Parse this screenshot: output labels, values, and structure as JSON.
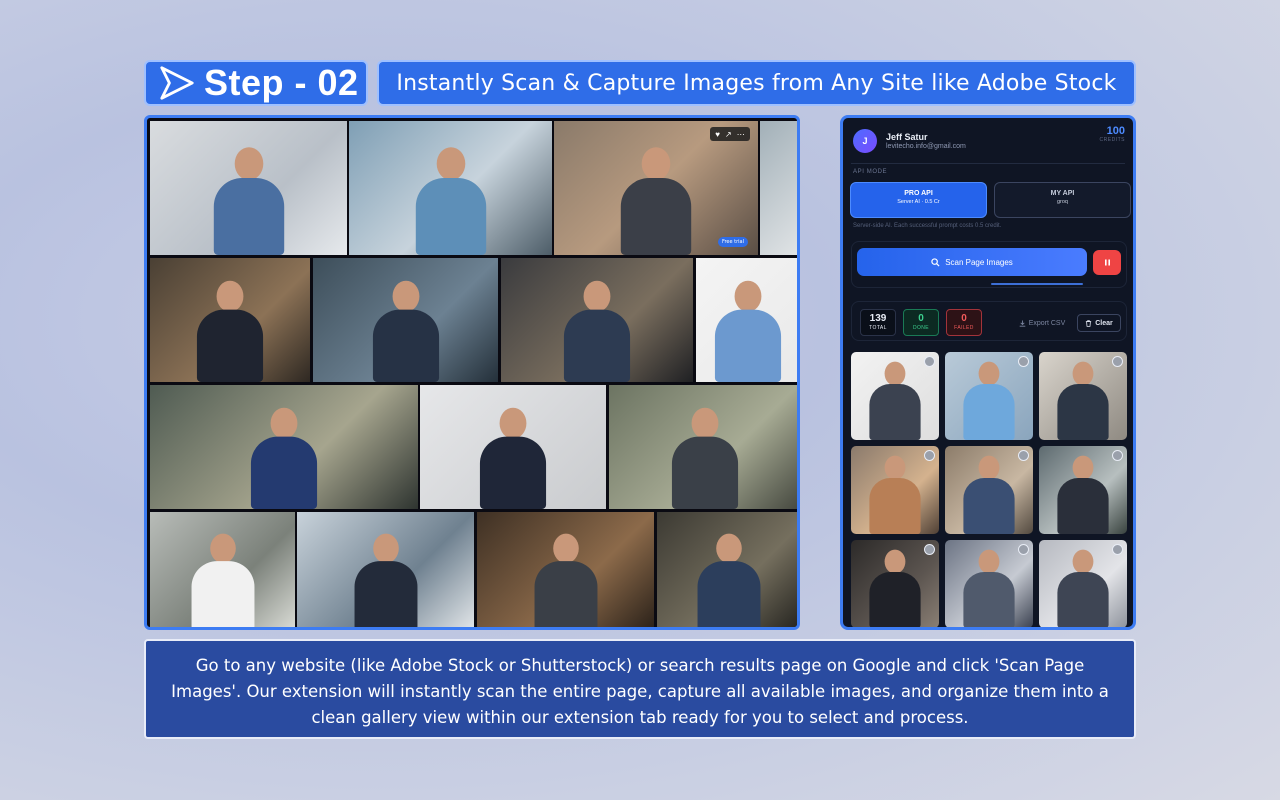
{
  "header": {
    "step_label": "Step - 02",
    "headline": "Instantly Scan & Capture Images from Any Site like Adobe Stock"
  },
  "gallery": {
    "free_trial_label": "Free trial",
    "photos": [
      {
        "bg": "linear-gradient(135deg,#d9dcdf,#b9c0c8 60%,#e6e9ec)",
        "suit": "#4a6fa1"
      },
      {
        "bg": "linear-gradient(135deg,#7f9fb5,#c7d3dc 55%,#4d5d68)",
        "suit": "#5d8fb8"
      },
      {
        "bg": "linear-gradient(135deg,#8a7a6a,#b79a7f 50%,#5a4e45)",
        "suit": "#3b3f48"
      },
      {
        "bg": "linear-gradient(135deg,#a2b0b8,#e1e4e6)",
        "suit": "#55636e"
      },
      {
        "bg": "linear-gradient(135deg,#4a4034,#8c7256 60%,#2e2822)",
        "suit": "#1f2430"
      },
      {
        "bg": "linear-gradient(135deg,#3d4e5a,#6c8192 60%,#24303a)",
        "suit": "#263245"
      },
      {
        "bg": "linear-gradient(135deg,#3a3b3e,#7a6e5e 60%,#1f2023)",
        "suit": "#2d3b52"
      },
      {
        "bg": "linear-gradient(135deg,#f4f4f4,#e9e9e9)",
        "suit": "#6c99cf"
      },
      {
        "bg": "linear-gradient(135deg,#4f5b52,#a6a58e 60%,#2e3430)",
        "suit": "#243a70"
      },
      {
        "bg": "linear-gradient(135deg,#e6e7e9,#c9cbce)",
        "suit": "#1f2638"
      },
      {
        "bg": "linear-gradient(135deg,#6c7462,#a7ab94 60%,#45483f)",
        "suit": "#3a4048"
      },
      {
        "bg": "linear-gradient(135deg,#b8bcb8,#7b817a 60%,#dadcd6)",
        "suit": "#f1f1f1"
      },
      {
        "bg": "linear-gradient(135deg,#c8d2da,#6f8190 60%,#e2e6e9)",
        "suit": "#232b3a"
      },
      {
        "bg": "linear-gradient(135deg,#3e3024,#8c6a4a 60%,#2a2119)",
        "suit": "#3a3f47"
      },
      {
        "bg": "linear-gradient(135deg,#3c3a33,#756f5e 60%,#24231f)",
        "suit": "#2c3e5c"
      }
    ]
  },
  "panel": {
    "user": {
      "initial": "J",
      "name": "Jeff Satur",
      "email": "levitecho.info@gmail.com"
    },
    "credits": {
      "value": "100",
      "label": "CREDITS"
    },
    "api_mode_label": "API MODE",
    "api_pro": {
      "title": "PRO API",
      "sub": "Server AI · 0.5 Cr"
    },
    "api_my": {
      "title": "MY API",
      "sub": "groq"
    },
    "api_note": "Server-side AI. Each successful prompt costs 0.5 credit.",
    "scan_label": "Scan Page Images",
    "stats": {
      "total": {
        "value": "139",
        "label": "TOTAL"
      },
      "done": {
        "value": "0",
        "label": "DONE"
      },
      "failed": {
        "value": "0",
        "label": "FAILED"
      }
    },
    "export_label": "Export CSV",
    "clear_label": "Clear",
    "thumbs": [
      {
        "bg": "linear-gradient(135deg,#f2f2f2,#dedede)",
        "suit": "#3b4250"
      },
      {
        "bg": "linear-gradient(135deg,#b9cad8,#8aa5bd)",
        "suit": "#6ea8dc"
      },
      {
        "bg": "linear-gradient(135deg,#d9d4cc,#8f8a82)",
        "suit": "#2c3645"
      },
      {
        "bg": "linear-gradient(135deg,#8a7a6c,#d4b28e 60%,#4f4035)",
        "suit": "#b87f56"
      },
      {
        "bg": "linear-gradient(135deg,#8c7c6a,#c8b7a2 60%,#534a40)",
        "suit": "#3a4f73"
      },
      {
        "bg": "linear-gradient(135deg,#5d6a6f,#b7bfbf 60%,#39433f)",
        "suit": "#2a2f3a"
      },
      {
        "bg": "linear-gradient(135deg,#2c2a29,#5c5550 60%,#8a7f74)",
        "suit": "#1f2128"
      },
      {
        "bg": "linear-gradient(135deg,#6c7484,#c6cad2 60%,#3a4150)",
        "suit": "#505a6c"
      },
      {
        "bg": "linear-gradient(135deg,#b6b9c0,#e3e4e8 60%,#8e939c)",
        "suit": "#3e4554"
      }
    ]
  },
  "caption": "Go to any website (like Adobe Stock or Shutterstock) or search results page on Google and click 'Scan Page Images'. Our extension will instantly scan the entire page, capture all available images, and organize them into a clean gallery view within our extension tab ready for you to select and process."
}
